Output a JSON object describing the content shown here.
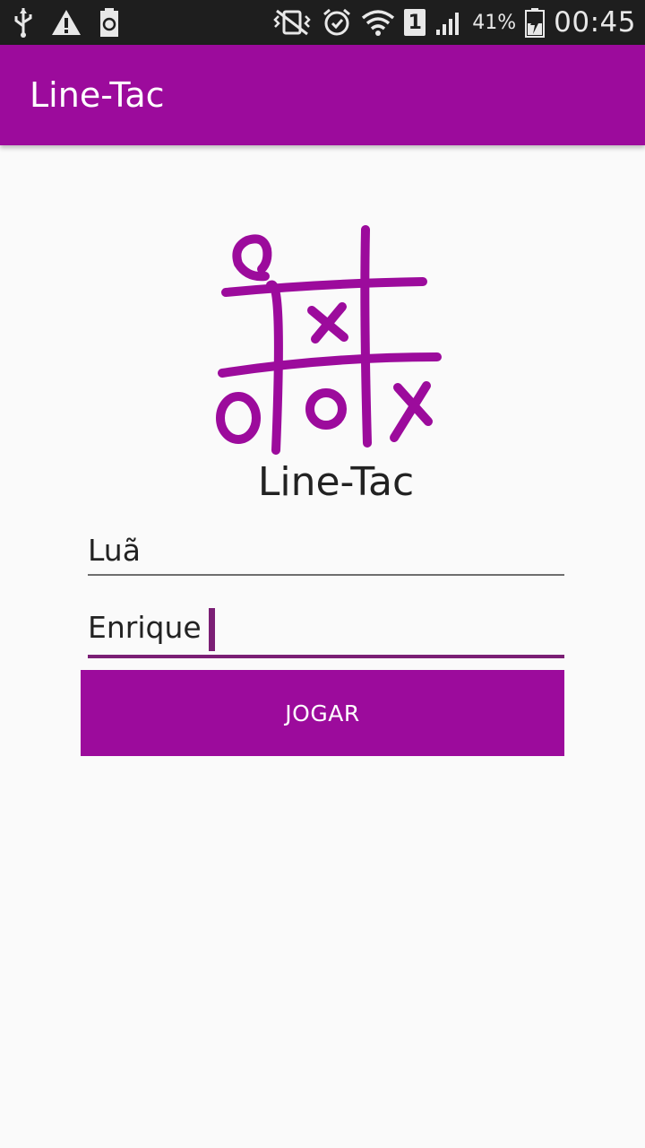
{
  "status_bar": {
    "icons_left": [
      "usb-icon",
      "warning-icon",
      "battery-saver-icon"
    ],
    "icons_right": [
      "vibrate-icon",
      "alarm-icon",
      "wifi-icon",
      "sim-icon",
      "signal-icon",
      "battery-icon"
    ],
    "sim_slot": "1",
    "battery_percent": "41%",
    "time": "00:45"
  },
  "app_bar": {
    "title": "Line-Tac"
  },
  "logo": {
    "icon": "tic-tac-toe-logo-icon",
    "title": "Line-Tac"
  },
  "form": {
    "player1_value": "Luã",
    "player2_value": "Enrique",
    "play_button_label": "JOGAR"
  },
  "colors": {
    "primary": "#9c0b9c",
    "accent": "#7b1f75",
    "background": "#fafafa",
    "status_bar": "#1e1e1e"
  }
}
